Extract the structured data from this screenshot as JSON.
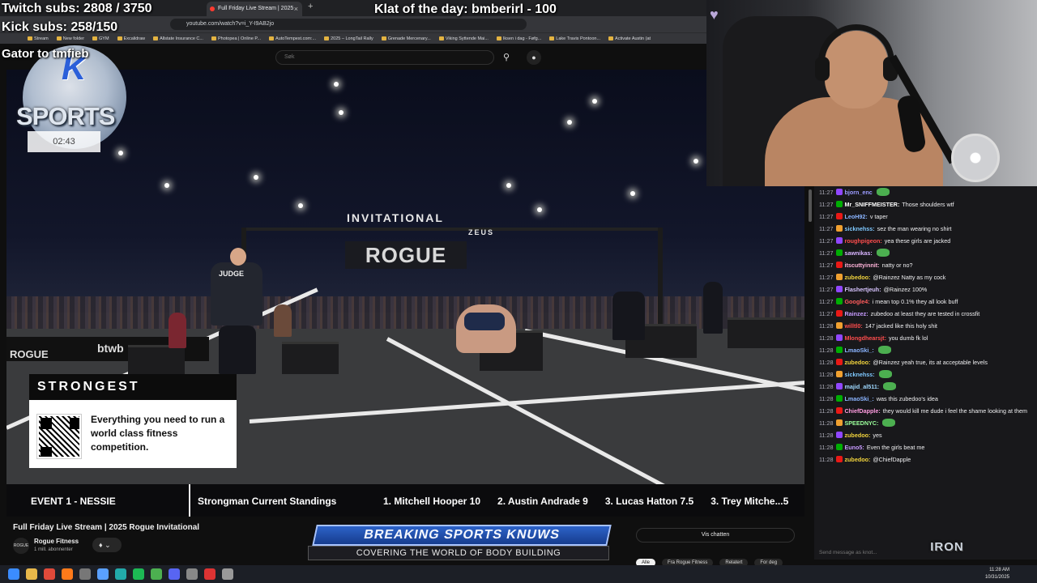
{
  "overlays": {
    "twitch_subs": "Twitch subs: 2808 / 3750",
    "kick_subs": "Kick subs: 258/150",
    "gator": "Gator          to tmfieb",
    "klat": "Klat of the day: bmberirl - 100",
    "logo_k": "K",
    "logo_sports": "SPORTS",
    "timer": "02:43"
  },
  "browser": {
    "tab_title": "Full Friday Live Stream | 2025",
    "tab_close": "×",
    "new_tab": "+",
    "url": "youtube.com/watch?v=i_Y-I9AB2jo",
    "bookmarks": [
      "Stream",
      "New folder",
      "GYM",
      "Excalidraw",
      "Allstate Insurance C...",
      "Photopea | Online P...",
      "AutoTempest.com:...",
      "2025 – LongTail Rally",
      "Grenade Mercenary...",
      "Viking Syttende Mai...",
      "Iksen i dag - Føfg...",
      "Lake Travis Pontoon...",
      "Activate Austin (at"
    ]
  },
  "youtube": {
    "search_placeholder": "Søk",
    "video_title": "Full Friday Live Stream | 2025 Rogue Invitational",
    "channel_name": "Rogue Fitness",
    "channel_avatar": "ROGUE",
    "channel_subs": "1 mill. abonnenter",
    "vis_chatten": "Vis chatten",
    "chips": [
      "Alle",
      "Fra Rogue Fitness",
      "Relatert",
      "For deg"
    ]
  },
  "video": {
    "invitational": "INVITATIONAL",
    "zeus": "ZEUS",
    "banner": "ROGUE",
    "judge": "JUDGE",
    "side_rogue": "ROGUE",
    "side_btwb": "btwb",
    "ad_heading": "STRONGEST",
    "ad_text": "Everything you need to run a world class fitness competition.",
    "ticker_event": "EVENT 1 - NESSIE",
    "ticker_title": "Strongman Current Standings",
    "standings": [
      "1. Mitchell Hooper  10",
      "2. Austin Andrade  9",
      "3. Lucas Hatton  7.5",
      "3. Trey Mitche...5"
    ]
  },
  "bsk": {
    "title": "BREAKING SPORTS KNUWS",
    "subtitle": "COVERING THE WORLD OF BODY BUILDING"
  },
  "chat": {
    "input_placeholder": "Send message as knot...",
    "messages": [
      {
        "time": "11:27",
        "user": "bjorn_enc",
        "text": "",
        "color": "#9b9bff"
      },
      {
        "time": "11:27",
        "user": "Mr_SNIFFMEISTER:",
        "text": "Those shoulders wtf",
        "color": "#ffffff"
      },
      {
        "time": "11:27",
        "user": "LeoH92:",
        "text": "v taper",
        "color": "#8ab4ff"
      },
      {
        "time": "11:27",
        "user": "sicknehss:",
        "text": "sez the man wearing no shirt",
        "color": "#7ec8ff"
      },
      {
        "time": "11:27",
        "user": "roughpigeon:",
        "text": "yea these girls are jacked",
        "color": "#ff4d4d"
      },
      {
        "time": "11:27",
        "user": "sawnikas:",
        "text": "",
        "color": "#d8b4ff"
      },
      {
        "time": "11:27",
        "user": "itscuttyinnit:",
        "text": "natty or no?",
        "color": "#ffb3d9"
      },
      {
        "time": "11:27",
        "user": "zubedoo:",
        "text": "@Rainzez Natty as my cock",
        "color": "#f2d43d"
      },
      {
        "time": "11:27",
        "user": "Flashertjeuh:",
        "text": "@Rainzez 100%",
        "color": "#d8c4ff"
      },
      {
        "time": "11:27",
        "user": "Google4:",
        "text": "i mean top 0.1% they all look buff",
        "color": "#ff5c5c"
      },
      {
        "time": "11:27",
        "user": "Rainzez:",
        "text": "zubedoo at least they are tested in crossfit",
        "color": "#c79bff"
      },
      {
        "time": "11:28",
        "user": "willtl0:",
        "text": "147 jacked like this holy shit",
        "color": "#ff4d4d"
      },
      {
        "time": "11:28",
        "user": "Mlongdhearsjt:",
        "text": "you dumb fk lol",
        "color": "#ff4d4d"
      },
      {
        "time": "11:28",
        "user": "LmaoSki_:",
        "text": "",
        "color": "#8ab4ff"
      },
      {
        "time": "11:28",
        "user": "zubedoo:",
        "text": "@Rainzez yeah true, its at acceptable levels",
        "color": "#f2d43d"
      },
      {
        "time": "11:28",
        "user": "sicknehss:",
        "text": "",
        "color": "#7ec8ff"
      },
      {
        "time": "11:28",
        "user": "majid_al511:",
        "text": "",
        "color": "#9fd8ff"
      },
      {
        "time": "11:28",
        "user": "LmaoSki_:",
        "text": "was this zubedoo's idea",
        "color": "#8ab4ff"
      },
      {
        "time": "11:28",
        "user": "ChiefDapple:",
        "text": "they would kill me dude i feel the shame looking at them",
        "color": "#ff9ce0"
      },
      {
        "time": "11:28",
        "user": "SPEEDNYC:",
        "text": "",
        "color": "#9bff9b"
      },
      {
        "time": "11:28",
        "user": "zubedoo:",
        "text": "yes",
        "color": "#f2d43d"
      },
      {
        "time": "11:28",
        "user": "Euno5:",
        "text": "Even the girls beat me",
        "color": "#c79bff"
      },
      {
        "time": "11:28",
        "user": "zubedoo:",
        "text": "@ChiefDapple",
        "color": "#f2d43d"
      }
    ]
  },
  "iron_logo": "IRON",
  "clock": {
    "time": "11:28 AM",
    "date": "10/31/2025"
  }
}
